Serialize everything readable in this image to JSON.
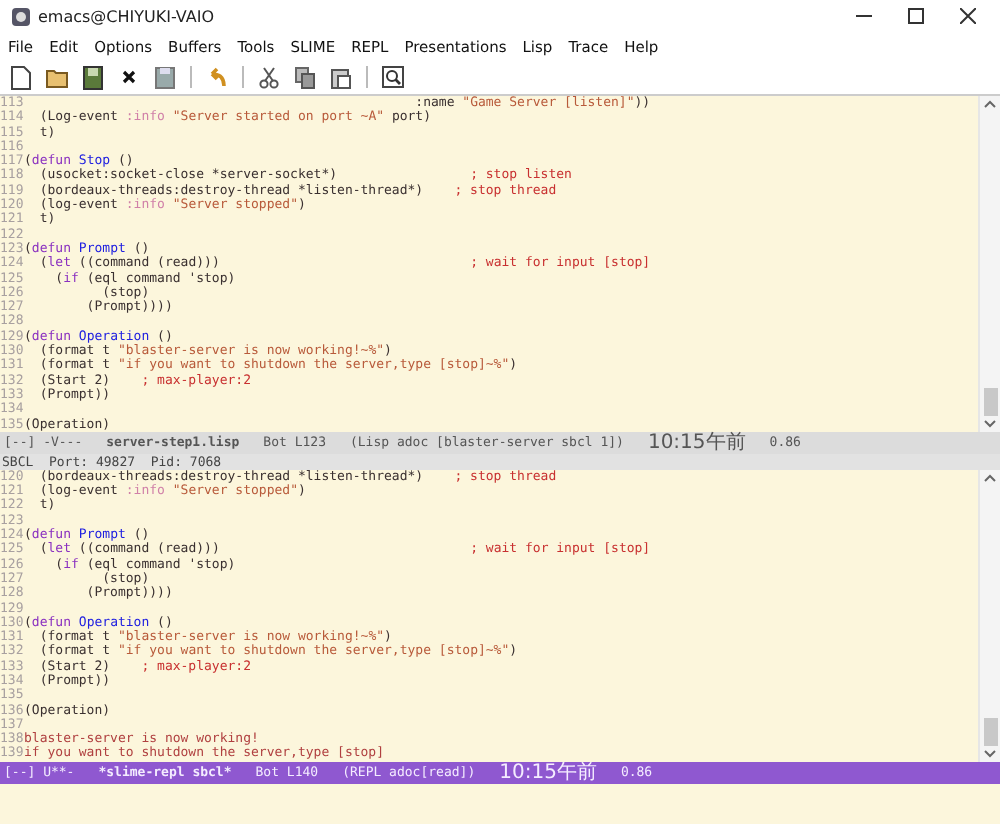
{
  "window": {
    "title": "emacs@CHIYUKI-VAIO"
  },
  "menu": [
    "File",
    "Edit",
    "Options",
    "Buffers",
    "Tools",
    "SLIME",
    "REPL",
    "Presentations",
    "Lisp",
    "Trace",
    "Help"
  ],
  "panes": [
    {
      "lines": [
        {
          "number": "113",
          "tokens": [
            {
              "kind": "plain",
              "text": "                                                  :name "
            },
            {
              "kind": "string",
              "text": "\"Game Server [listen]\""
            },
            {
              "kind": "plain",
              "text": "))"
            }
          ]
        },
        {
          "number": "114",
          "tokens": [
            {
              "kind": "plain",
              "text": "  (Log-event "
            },
            {
              "kind": "constant",
              "text": ":info"
            },
            {
              "kind": "string",
              "text": " \"Server started on port ~A\""
            },
            {
              "kind": "plain",
              "text": " port)"
            }
          ]
        },
        {
          "number": "115",
          "tokens": [
            {
              "kind": "plain",
              "text": "  t)"
            }
          ]
        },
        {
          "number": "116"
        },
        {
          "number": "117",
          "tokens": [
            {
              "kind": "plain",
              "text": "("
            },
            {
              "kind": "keyword",
              "text": "defun"
            },
            {
              "kind": "function",
              "text": " Stop"
            },
            {
              "kind": "plain",
              "text": " ()"
            }
          ]
        },
        {
          "number": "118",
          "tokens": [
            {
              "kind": "plain",
              "text": "  (usocket:socket-close *server-socket*)                 "
            },
            {
              "kind": "comment",
              "text": "; stop listen"
            }
          ]
        },
        {
          "number": "119",
          "tokens": [
            {
              "kind": "plain",
              "text": "  (bordeaux-threads:destroy-thread *listen-thread*)    "
            },
            {
              "kind": "comment",
              "text": "; stop thread"
            }
          ]
        },
        {
          "number": "120",
          "tokens": [
            {
              "kind": "plain",
              "text": "  (log-event "
            },
            {
              "kind": "constant",
              "text": ":info"
            },
            {
              "kind": "string",
              "text": " \"Server stopped\""
            },
            {
              "kind": "plain",
              "text": ")"
            }
          ]
        },
        {
          "number": "121",
          "tokens": [
            {
              "kind": "plain",
              "text": "  t)"
            }
          ]
        },
        {
          "number": "122"
        },
        {
          "number": "123",
          "tokens": [
            {
              "kind": "plain",
              "text": "("
            },
            {
              "kind": "keyword",
              "text": "defun"
            },
            {
              "kind": "function",
              "text": " Prompt"
            },
            {
              "kind": "plain",
              "text": " ()"
            }
          ]
        },
        {
          "number": "124",
          "tokens": [
            {
              "kind": "plain",
              "text": "  ("
            },
            {
              "kind": "keyword",
              "text": "let"
            },
            {
              "kind": "plain",
              "text": " ((command (read)))                                "
            },
            {
              "kind": "comment",
              "text": "; wait for input [stop]"
            }
          ]
        },
        {
          "number": "125",
          "tokens": [
            {
              "kind": "plain",
              "text": "    ("
            },
            {
              "kind": "keyword",
              "text": "if"
            },
            {
              "kind": "plain",
              "text": " (eql command 'stop)"
            }
          ]
        },
        {
          "number": "126",
          "tokens": [
            {
              "kind": "plain",
              "text": "          (stop)"
            }
          ]
        },
        {
          "number": "127",
          "tokens": [
            {
              "kind": "plain",
              "text": "        (Prompt))))"
            }
          ]
        },
        {
          "number": "128"
        },
        {
          "number": "129",
          "tokens": [
            {
              "kind": "plain",
              "text": "("
            },
            {
              "kind": "keyword",
              "text": "defun"
            },
            {
              "kind": "function",
              "text": " Operation"
            },
            {
              "kind": "plain",
              "text": " ()"
            }
          ]
        },
        {
          "number": "130",
          "tokens": [
            {
              "kind": "plain",
              "text": "  (format t "
            },
            {
              "kind": "string",
              "text": "\"blaster-server is now working!~%\""
            },
            {
              "kind": "plain",
              "text": ")"
            }
          ]
        },
        {
          "number": "131",
          "tokens": [
            {
              "kind": "plain",
              "text": "  (format t "
            },
            {
              "kind": "string",
              "text": "\"if you want to shutdown the server,type [stop]~%\""
            },
            {
              "kind": "plain",
              "text": ")"
            }
          ]
        },
        {
          "number": "132",
          "tokens": [
            {
              "kind": "plain",
              "text": "  (Start 2)    "
            },
            {
              "kind": "comment",
              "text": "; max-player:2"
            }
          ]
        },
        {
          "number": "133",
          "tokens": [
            {
              "kind": "plain",
              "text": "  (Prompt))"
            }
          ]
        },
        {
          "number": "134"
        },
        {
          "number": "135",
          "tokens": [
            {
              "kind": "plain",
              "text": "(Operation)"
            }
          ]
        }
      ],
      "mode_line": {
        "active": false,
        "segments": [
          {
            "kind": "plain",
            "text": "[--] -V---"
          },
          {
            "kind": "buffer",
            "text": "server-step1.lisp"
          },
          {
            "kind": "plain",
            "text": "Bot L123"
          },
          {
            "kind": "plain",
            "text": "(Lisp adoc [blaster-server sbcl 1])"
          },
          {
            "kind": "time",
            "text": "10:15午前"
          },
          {
            "kind": "plain",
            "text": "0.86"
          }
        ]
      }
    },
    {
      "header_line": "SBCL  Port: 49827  Pid: 7068",
      "lines": [
        {
          "number": "120",
          "tokens": [
            {
              "kind": "plain",
              "text": "  (bordeaux-threads:destroy-thread *listen-thread*)    "
            },
            {
              "kind": "comment",
              "text": "; stop thread"
            }
          ]
        },
        {
          "number": "121",
          "tokens": [
            {
              "kind": "plain",
              "text": "  (log-event "
            },
            {
              "kind": "constant",
              "text": ":info"
            },
            {
              "kind": "string",
              "text": " \"Server stopped\""
            },
            {
              "kind": "plain",
              "text": ")"
            }
          ]
        },
        {
          "number": "122",
          "tokens": [
            {
              "kind": "plain",
              "text": "  t)"
            }
          ]
        },
        {
          "number": "123"
        },
        {
          "number": "124",
          "tokens": [
            {
              "kind": "plain",
              "text": "("
            },
            {
              "kind": "keyword",
              "text": "defun"
            },
            {
              "kind": "function",
              "text": " Prompt"
            },
            {
              "kind": "plain",
              "text": " ()"
            }
          ]
        },
        {
          "number": "125",
          "tokens": [
            {
              "kind": "plain",
              "text": "  ("
            },
            {
              "kind": "keyword",
              "text": "let"
            },
            {
              "kind": "plain",
              "text": " ((command (read)))                                "
            },
            {
              "kind": "comment",
              "text": "; wait for input [stop]"
            }
          ]
        },
        {
          "number": "126",
          "tokens": [
            {
              "kind": "plain",
              "text": "    ("
            },
            {
              "kind": "keyword",
              "text": "if"
            },
            {
              "kind": "plain",
              "text": " (eql command 'stop)"
            }
          ]
        },
        {
          "number": "127",
          "tokens": [
            {
              "kind": "plain",
              "text": "          (stop)"
            }
          ]
        },
        {
          "number": "128",
          "tokens": [
            {
              "kind": "plain",
              "text": "        (Prompt))))"
            }
          ]
        },
        {
          "number": "129"
        },
        {
          "number": "130",
          "tokens": [
            {
              "kind": "plain",
              "text": "("
            },
            {
              "kind": "keyword",
              "text": "defun"
            },
            {
              "kind": "function",
              "text": " Operation"
            },
            {
              "kind": "plain",
              "text": " ()"
            }
          ]
        },
        {
          "number": "131",
          "tokens": [
            {
              "kind": "plain",
              "text": "  (format t "
            },
            {
              "kind": "string",
              "text": "\"blaster-server is now working!~%\""
            },
            {
              "kind": "plain",
              "text": ")"
            }
          ]
        },
        {
          "number": "132",
          "tokens": [
            {
              "kind": "plain",
              "text": "  (format t "
            },
            {
              "kind": "string",
              "text": "\"if you want to shutdown the server,type [stop]~%\""
            },
            {
              "kind": "plain",
              "text": ")"
            }
          ]
        },
        {
          "number": "133",
          "tokens": [
            {
              "kind": "plain",
              "text": "  (Start 2)    "
            },
            {
              "kind": "comment",
              "text": "; max-player:2"
            }
          ]
        },
        {
          "number": "134",
          "tokens": [
            {
              "kind": "plain",
              "text": "  (Prompt))"
            }
          ]
        },
        {
          "number": "135"
        },
        {
          "number": "136",
          "tokens": [
            {
              "kind": "plain",
              "text": "(Operation)"
            }
          ]
        },
        {
          "number": "137"
        },
        {
          "number": "138",
          "tokens": [
            {
              "kind": "output",
              "text": "blaster-server is now working!"
            }
          ]
        },
        {
          "number": "139",
          "tokens": [
            {
              "kind": "output",
              "text": "if you want to shutdown the server,type [stop]"
            }
          ]
        }
      ],
      "mode_line": {
        "active": true,
        "segments": [
          {
            "kind": "plain",
            "text": "[--] U**-"
          },
          {
            "kind": "buffer",
            "text": "*slime-repl sbcl*"
          },
          {
            "kind": "plain",
            "text": "Bot L140"
          },
          {
            "kind": "plain",
            "text": "(REPL adoc[read])"
          },
          {
            "kind": "time",
            "text": "10:15午前"
          },
          {
            "kind": "plain",
            "text": "0.86"
          }
        ]
      }
    }
  ]
}
